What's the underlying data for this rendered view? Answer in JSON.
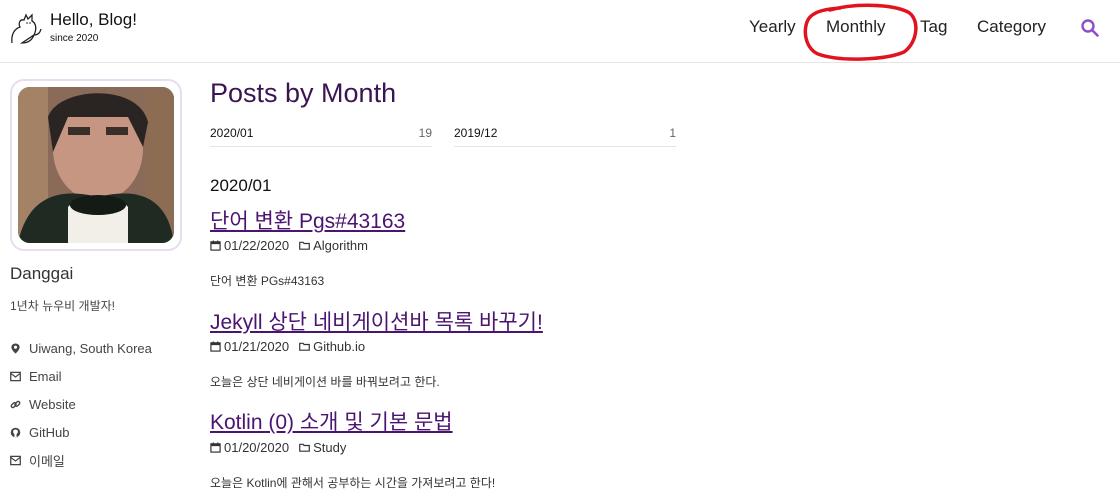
{
  "header": {
    "title": "Hello, Blog!",
    "subtitle": "since 2020",
    "nav": [
      "Yearly",
      "Monthly",
      "Tag",
      "Category"
    ],
    "accent_color": "#8e4fc8"
  },
  "sidebar": {
    "author_name": "Danggai",
    "bio": "1년차 뉴우비 개발자!",
    "links": [
      {
        "icon": "map-marker-icon",
        "label": "Uiwang, South Korea"
      },
      {
        "icon": "envelope-icon",
        "label": "Email"
      },
      {
        "icon": "link-icon",
        "label": "Website"
      },
      {
        "icon": "github-icon",
        "label": "GitHub"
      },
      {
        "icon": "envelope-icon",
        "label": "이메일"
      }
    ]
  },
  "main": {
    "title": "Posts by Month",
    "months": [
      {
        "label": "2020/01",
        "count": "19"
      },
      {
        "label": "2019/12",
        "count": "1"
      }
    ],
    "section_heading": "2020/01",
    "posts": [
      {
        "title": "단어 변환 Pgs#43163",
        "date": "01/22/2020",
        "category": "Algorithm",
        "excerpt": "단어 변환 PGs#43163"
      },
      {
        "title": "Jekyll 상단 네비게이션바 목록 바꾸기!",
        "date": "01/21/2020",
        "category": "Github.io",
        "excerpt": "오늘은 상단 네비게이션 바를 바꿔보려고 한다."
      },
      {
        "title": "Kotlin (0) 소개 및 기본 문법",
        "date": "01/20/2020",
        "category": "Study",
        "excerpt": "오늘은 Kotlin에 관해서 공부하는 시간을 가져보려고 한다!"
      }
    ]
  },
  "annotation": {
    "highlight_color": "#e0141e"
  }
}
